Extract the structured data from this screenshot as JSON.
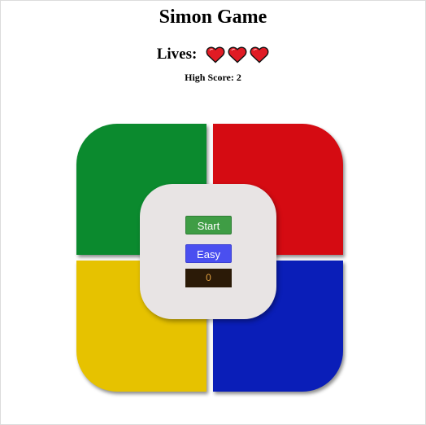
{
  "header": {
    "title": "Simon Game",
    "lives_label": "Lives:",
    "lives_count": 3,
    "high_score_text": "High Score: 2"
  },
  "controls": {
    "start_label": "Start",
    "difficulty_label": "Easy",
    "score_value": "0"
  },
  "pads": {
    "green": "#0b8a2e",
    "red": "#d50b12",
    "yellow": "#e6c200",
    "blue": "#0a1eb8"
  },
  "icons": {
    "life": "heart-icon"
  }
}
